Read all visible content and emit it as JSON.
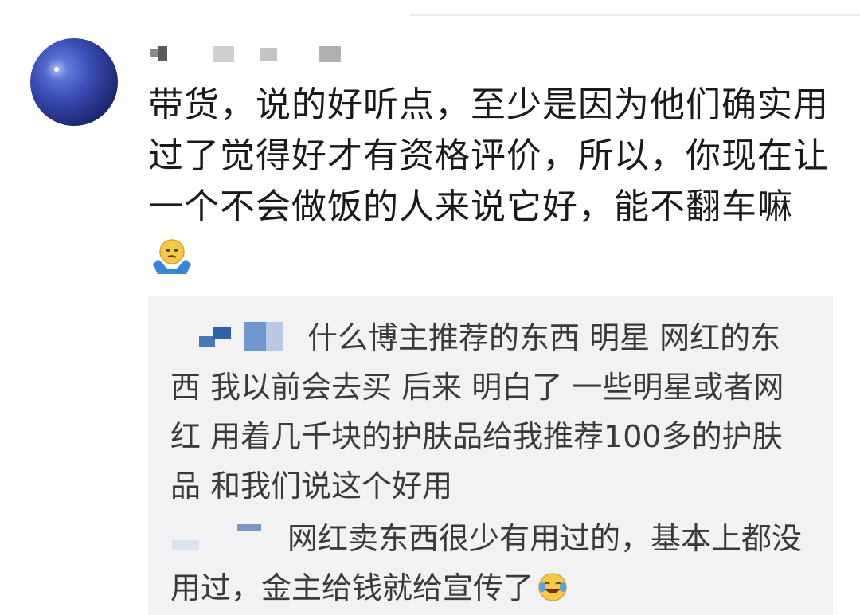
{
  "comment": {
    "text": "带货，说的好听点，至少是因为他们确实用过了觉得好才有资格评价，所以，你现在让一个不会做饭的人来说它好，能不翻车嘛",
    "emoji": "shrug-emoji"
  },
  "reply": {
    "text": "什么博主推荐的东西 明星 网红的东西 我以前会去买 后来 明白了 一些明星或者网红 用着几千块的护肤品给我推荐100多的护肤品 和我们说这个好用"
  },
  "sub_reply": {
    "text": "网红卖东西很少有用过的，基本上都没用过，金主给钱就给宣传了",
    "emoji": "laughing-tears-emoji"
  },
  "colors": {
    "avatar": "#2b3a9e",
    "reply_background": "#f2f2f4",
    "text": "#1a1a1a",
    "reply_text": "#3a3a3a"
  }
}
